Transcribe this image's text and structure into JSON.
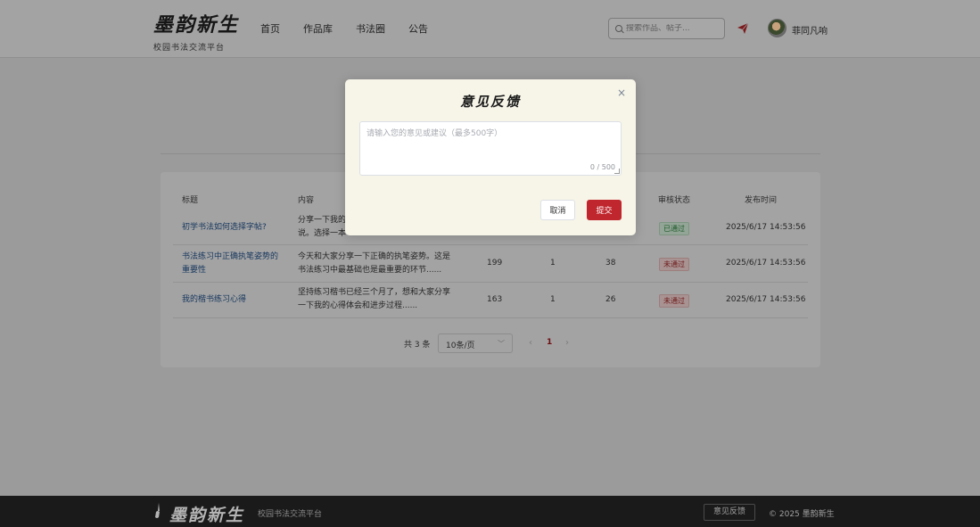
{
  "header": {
    "logo": "墨韵新生",
    "subtitle": "校园书法交流平台",
    "nav": [
      "首页",
      "作品库",
      "书法圈",
      "公告"
    ],
    "search_placeholder": "搜索作品、帖子...",
    "username": "菲同凡响"
  },
  "table": {
    "columns": {
      "title": "标题",
      "content": "内容",
      "status": "审核状态",
      "time": "发布时间"
    },
    "rows": [
      {
        "title": "初学书法如何选择字帖?",
        "content_line1": "分享一下我的",
        "content_line2": "说。选择一本",
        "views": "",
        "likes": "",
        "comments": "",
        "status": "已通过",
        "time": "2025/6/17 14:53:56"
      },
      {
        "title_line1": "书法练习中正确执笔姿势的",
        "title_line2": "重要性",
        "content_line1": "今天和大家分享一下正确的执笔姿势。这是",
        "content_line2": "书法练习中最基础也是最重要的环节......",
        "views": "199",
        "likes": "1",
        "comments": "38",
        "status": "未通过",
        "time": "2025/6/17 14:53:56"
      },
      {
        "title": "我的楷书练习心得",
        "content_line1": "坚持练习楷书已经三个月了，想和大家分享",
        "content_line2": "一下我的心得体会和进步过程......",
        "views": "163",
        "likes": "1",
        "comments": "26",
        "status": "未通过",
        "time": "2025/6/17 14:53:56"
      }
    ]
  },
  "pagination": {
    "total": "共 3 条",
    "page_size": "10条/页",
    "current": "1"
  },
  "footer": {
    "logo": "墨韵新生",
    "subtitle": "校园书法交流平台",
    "feedback": "意见反馈",
    "copyright": "© 2025 墨韵新生"
  },
  "modal": {
    "title": "意见反馈",
    "placeholder": "请输入您的意见或建议（最多500字）",
    "counter": "0 / 500",
    "cancel": "取消",
    "submit": "提交",
    "close": "×"
  },
  "colors": {
    "accent": "#c0262d",
    "modal_bg": "#f7f5e8"
  }
}
